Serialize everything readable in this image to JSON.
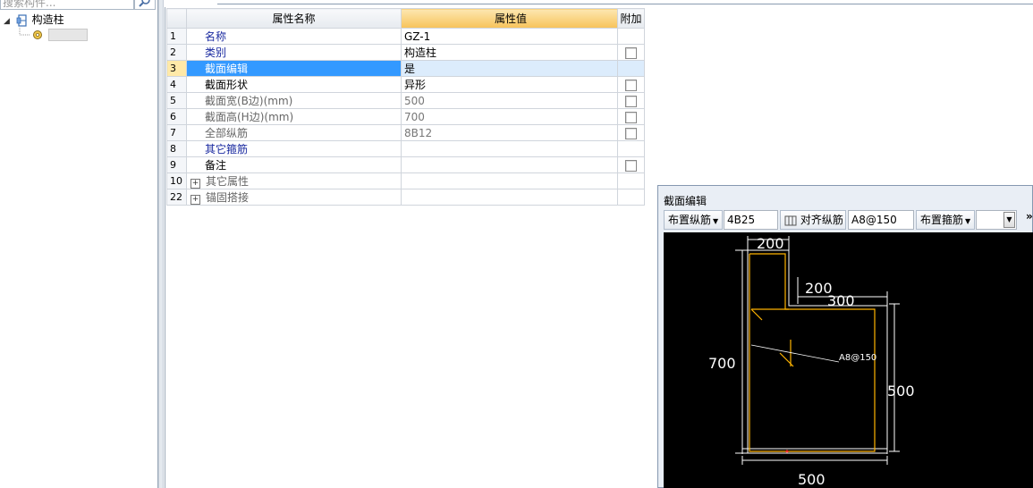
{
  "tree": {
    "search_placeholder": "搜索构件...",
    "root_label": "构造柱"
  },
  "grid": {
    "headers": {
      "name": "属性名称",
      "value": "属性值",
      "add": "附加"
    },
    "rows": [
      {
        "num": "1",
        "name": "名称",
        "value": "GZ-1",
        "checkbox": false,
        "name_style": "blue",
        "value_style": "normal"
      },
      {
        "num": "2",
        "name": "类别",
        "value": "构造柱",
        "checkbox": true,
        "name_style": "blue",
        "value_style": "normal"
      },
      {
        "num": "3",
        "name": "截面编辑",
        "value": "是",
        "checkbox": false,
        "name_style": "blue",
        "value_style": "normal",
        "selected": true
      },
      {
        "num": "4",
        "name": "截面形状",
        "value": "异形",
        "checkbox": true,
        "name_style": "black",
        "value_style": "normal"
      },
      {
        "num": "5",
        "name": "截面宽(B边)(mm)",
        "value": "500",
        "checkbox": true,
        "name_style": "gray",
        "value_style": "gray"
      },
      {
        "num": "6",
        "name": "截面高(H边)(mm)",
        "value": "700",
        "checkbox": true,
        "name_style": "gray",
        "value_style": "gray"
      },
      {
        "num": "7",
        "name": "全部纵筋",
        "value": "8B12",
        "checkbox": true,
        "name_style": "gray",
        "value_style": "gray"
      },
      {
        "num": "8",
        "name": "其它箍筋",
        "value": "",
        "checkbox": false,
        "name_style": "blue",
        "value_style": "normal"
      },
      {
        "num": "9",
        "name": "备注",
        "value": "",
        "checkbox": true,
        "name_style": "black",
        "value_style": "normal"
      },
      {
        "num": "10",
        "name": "其它属性",
        "value": "",
        "checkbox": false,
        "name_style": "gray",
        "value_style": "normal",
        "expandable": true
      },
      {
        "num": "22",
        "name": "锚固搭接",
        "value": "",
        "checkbox": false,
        "name_style": "gray",
        "value_style": "normal",
        "expandable": true
      }
    ]
  },
  "editor": {
    "title": "截面编辑",
    "toolbar": {
      "place_long_bar": "布置纵筋",
      "long_bar_value": "4B25",
      "align_long_bar": "对齐纵筋",
      "stirrup_value": "A8@150",
      "place_stirrup": "布置箍筋",
      "more": "»"
    },
    "drawing": {
      "dim_top_partial": "200",
      "dim_step_200": "200",
      "dim_step_300": "300",
      "dim_height_700": "700",
      "dim_right_500": "500",
      "dim_bottom_500": "500",
      "stirrup_label": "A8@150"
    },
    "colors": {
      "outline": "#ffffff",
      "rebar": "#ffb400",
      "canvas": "#000000"
    }
  }
}
